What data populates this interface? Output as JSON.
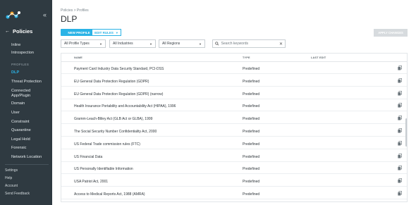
{
  "sidebar": {
    "heading": "Policies",
    "items_top": [
      "Inline",
      "Introspection"
    ],
    "section_label": "PROFILES",
    "items_profiles": [
      "DLP",
      "Threat Protection",
      "Connected App/Plugin",
      "Domain",
      "User",
      "Constraint",
      "Quarantine",
      "Legal Hold",
      "Forensic",
      "Network Location"
    ],
    "active": "DLP",
    "footer": [
      "Settings",
      "Help",
      "Account",
      "Send Feedback"
    ]
  },
  "main": {
    "breadcrumb": "Policies > Profiles",
    "title": "DLP",
    "new_profile_label": "NEW PROFILE",
    "edit_rules_label": "EDIT RULES",
    "apply_changes_label": "APPLY CHANGES",
    "filters": [
      "All Profile Types",
      "All Industries",
      "All Regions"
    ],
    "search_placeholder": "Search keywords",
    "columns": [
      "NAME",
      "TYPE",
      "LAST EDIT"
    ],
    "rows": [
      {
        "name": "Payment Card Industry Data Security Standard, PCI-DSS",
        "type": "Predefined"
      },
      {
        "name": "EU General Data Protection Regulation (GDPR)",
        "type": "Predefined"
      },
      {
        "name": "EU General Data Protection Regulation (GDPR) (narrow)",
        "type": "Predefined"
      },
      {
        "name": "Health Insurance Portability and Accountability Act (HIPAA), 1996",
        "type": "Predefined"
      },
      {
        "name": "Gramm-Leach-Bliley Act (GLB Act or GLBA), 1999",
        "type": "Predefined"
      },
      {
        "name": "The Social Security Number Confidentiality Act, 2000",
        "type": "Predefined"
      },
      {
        "name": "US Federal Trade commission rules (FTC)",
        "type": "Predefined"
      },
      {
        "name": "US Financial Data",
        "type": "Predefined"
      },
      {
        "name": "US Personally Identifiable Information",
        "type": "Predefined"
      },
      {
        "name": "USA Patriot Act, 2001",
        "type": "Predefined"
      },
      {
        "name": "Access to Medical Reports Act, 1988 (AMRA)",
        "type": "Predefined"
      }
    ]
  },
  "colors": {
    "sidebar_bg": "#2f3a41",
    "accent": "#2bb3e6",
    "disabled": "#d7dbde"
  },
  "icons": [
    "back-arrow-icon",
    "collapse-chevron-icon",
    "dropdown-caret-icon",
    "search-icon",
    "clear-x-icon",
    "copy-icon"
  ]
}
